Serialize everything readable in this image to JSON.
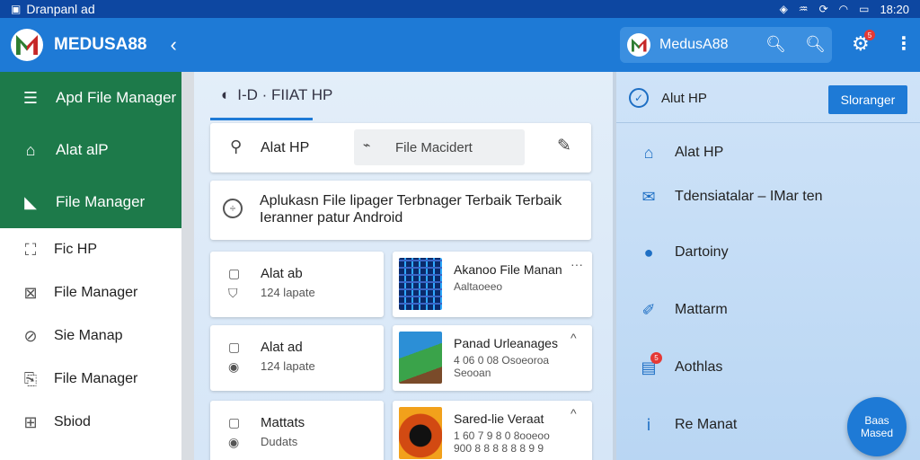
{
  "statusbar": {
    "title": "Dranpanl ad",
    "time": "18:20"
  },
  "appbar": {
    "title": "MEDUSA88"
  },
  "pill": {
    "title": "MedusA88"
  },
  "gear_badge": "5",
  "drawer": {
    "header_items": [
      {
        "label": "Apd File Manager",
        "icon": "menu-icon"
      },
      {
        "label": "Alat alP",
        "icon": "home-icon"
      },
      {
        "label": "File Manager",
        "icon": "folder-icon"
      }
    ],
    "items": [
      {
        "label": "Fic HP",
        "icon": "image-icon"
      },
      {
        "label": "File Manager",
        "icon": "box-icon"
      },
      {
        "label": "Sie Manap",
        "icon": "compass-icon"
      },
      {
        "label": "File Manager",
        "icon": "file-icon"
      },
      {
        "label": "Sbiod",
        "icon": "grid-icon"
      }
    ]
  },
  "center": {
    "breadcrumb": "I-D · FIIAT HP",
    "search": {
      "label": "Alat HP",
      "field": "File Macidert"
    },
    "description": "Aplukasn File lipager Terbnager Terbaik Terbaik Ieranner patur Android",
    "files": [
      {
        "name": "Alat ab",
        "sub": "124 lapate"
      },
      {
        "name": "Alat ad",
        "sub": "124 lapate"
      },
      {
        "name": "Mattats",
        "sub": "Dudats"
      }
    ],
    "apps": [
      {
        "name": "Akanoo File Manan",
        "sub": "Aaltaoeeo",
        "more": "···"
      },
      {
        "name": "Panad Urleanages",
        "sub": "4 06 0 08 Osoeoroa Seooan",
        "more": "^"
      },
      {
        "name": "Sared-lie Veraat",
        "sub": "1 60 7 9 8 0 8ooeoo 900 8 8 8 8 8 8 9 9",
        "more": "^"
      }
    ]
  },
  "right": {
    "header": "Alut HP",
    "storage_button": "Sloranger",
    "badge": "5",
    "items": [
      {
        "label": "Alat HP",
        "icon": "home-icon"
      },
      {
        "label": "Tdensiatalar – IMar ten",
        "icon": "mail-icon"
      },
      {
        "label": "Dartoiny",
        "icon": "person-icon"
      },
      {
        "label": "Mattarm",
        "icon": "edit-icon"
      },
      {
        "label": "Aothlas",
        "icon": "calendar-icon"
      },
      {
        "label": "Re Manat",
        "icon": "info-icon"
      }
    ]
  },
  "fab": {
    "label": "Baas Mased"
  }
}
